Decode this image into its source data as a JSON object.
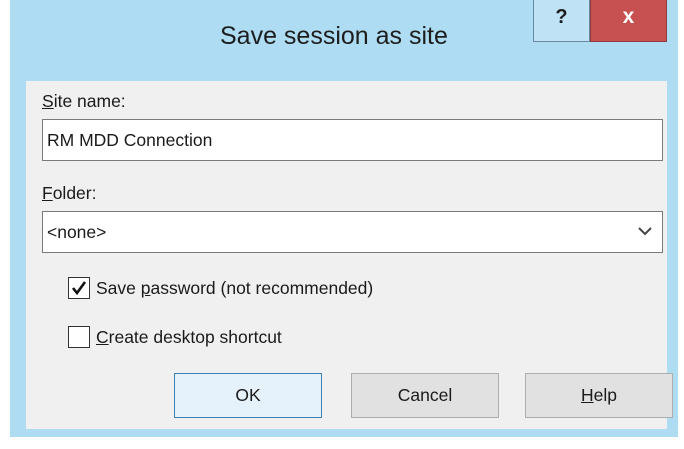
{
  "dialog": {
    "title": "Save session as site",
    "help_glyph": "?",
    "close_glyph": "x"
  },
  "site_name": {
    "label_accel": "S",
    "label_rest": "ite name:",
    "value": "RM MDD Connection"
  },
  "folder": {
    "label_accel": "F",
    "label_rest": "older:",
    "selected": "<none>",
    "icon": "chevron-down-icon"
  },
  "save_password": {
    "label_pre": "Save ",
    "label_accel": "p",
    "label_post": "assword (not recommended)",
    "checked": true
  },
  "desktop_shortcut": {
    "label_accel": "C",
    "label_post": "reate desktop shortcut",
    "checked": false
  },
  "buttons": {
    "ok": "OK",
    "cancel": "Cancel",
    "help_accel": "H",
    "help_rest": "elp"
  }
}
